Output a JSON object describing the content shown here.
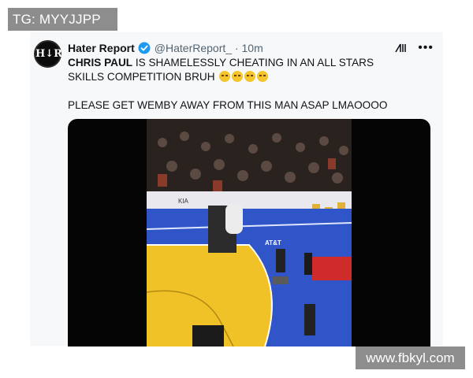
{
  "badge": {
    "label": "TG: MYYJJPP"
  },
  "tweet": {
    "avatar_text": "H↓R",
    "author_name": "Hater Report",
    "handle_time": "@HaterReport_ · 10m",
    "line1_bold": "CHRIS PAUL",
    "line1_rest": " IS SHAMELESSLY CHEATING IN AN ALL STARS SKILLS COMPETITION BRUH",
    "line2": "PLEASE GET WEMBY AWAY FROM THIS MAN ASAP LMAOOOO",
    "banner_att": "AT&T",
    "banner_tag": "KIA",
    "emoji_count": 4
  },
  "watermark": {
    "label": "www.fbkyl.com"
  },
  "colors": {
    "court_blue": "#2f55c8",
    "court_yellow": "#f0c227",
    "verified_blue": "#1d9bf0"
  },
  "icons": [
    "verified-badge-icon",
    "grok-icon",
    "more-options-icon"
  ]
}
